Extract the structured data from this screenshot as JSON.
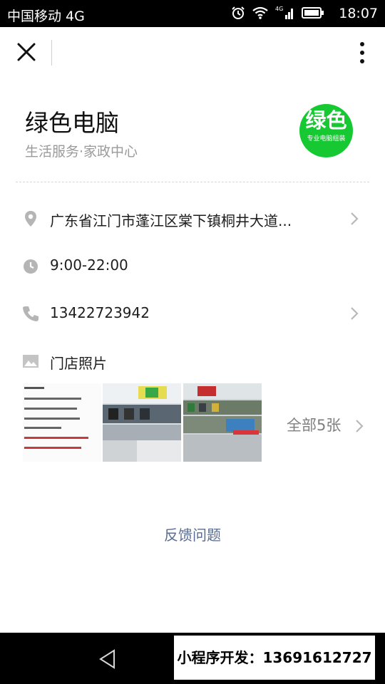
{
  "status_bar": {
    "carrier": "中国移动 4G",
    "time": "18:07",
    "icons": [
      "alarm-icon",
      "wifi-icon",
      "signal-4g-icon",
      "battery-icon"
    ]
  },
  "top_bar": {
    "close_icon": "close-icon",
    "more_icon": "more-vertical-icon"
  },
  "shop": {
    "name": "绿色电脑",
    "category": "生活服务·家政中心",
    "logo_text": "绿色",
    "logo_subtext": "专业电脑组装",
    "logo_color": "#16c832"
  },
  "details": {
    "address": "广东省江门市蓬江区棠下镇桐井大道...",
    "hours": "9:00-22:00",
    "phone": "13422723942"
  },
  "photos": {
    "label": "门店照片",
    "see_all": "全部5张"
  },
  "feedback": "反馈问题",
  "nav_bar": {
    "back_icon": "back-triangle-icon"
  },
  "banner": {
    "text": "小程序开发：13691612727"
  },
  "colors": {
    "link": "#5a6c8f",
    "muted": "#9a9a9a",
    "icon_gray": "#b5b5b5"
  }
}
